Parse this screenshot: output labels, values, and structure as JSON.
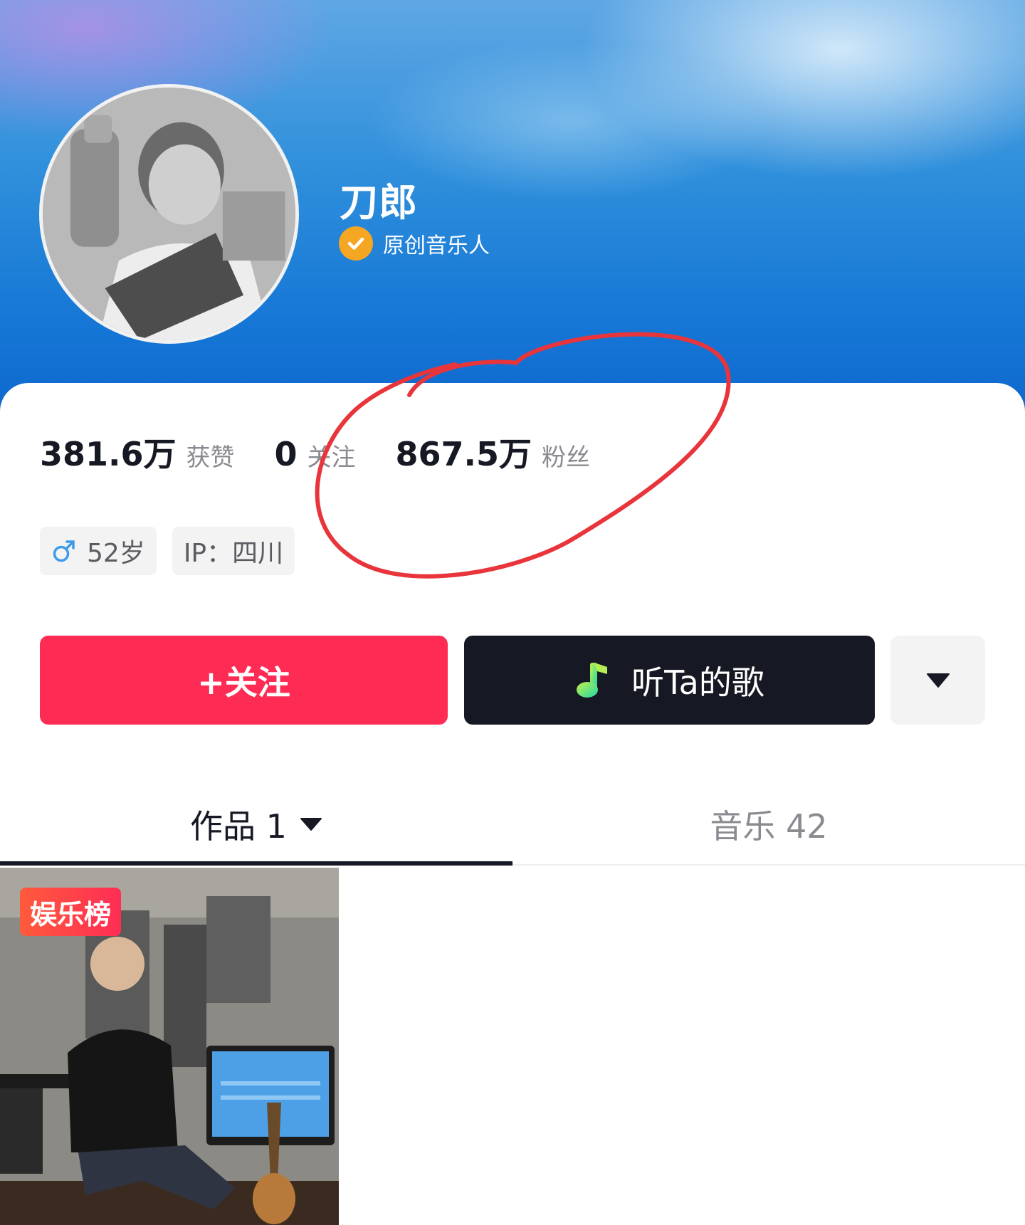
{
  "profile": {
    "name": "刀郎",
    "verification": "原创音乐人"
  },
  "stats": {
    "likes_value": "381.6万",
    "likes_label": "获赞",
    "following_value": "0",
    "following_label": "关注",
    "followers_value": "867.5万",
    "followers_label": "粉丝"
  },
  "tags": {
    "gender_icon": "male-icon",
    "age": "52岁",
    "ip": "IP：四川"
  },
  "actions": {
    "follow_label": "+关注",
    "music_label": "听Ta的歌",
    "music_icon": "music-note-icon",
    "more_icon": "caret-down-icon"
  },
  "tabs": {
    "works_label": "作品 1",
    "music_label": "音乐 42"
  },
  "video": {
    "badge": "娱乐榜"
  },
  "colors": {
    "accent": "#fe2c55",
    "dark_button": "#161823",
    "verified": "#f5a623",
    "annotation_circle": "#e8353b"
  }
}
